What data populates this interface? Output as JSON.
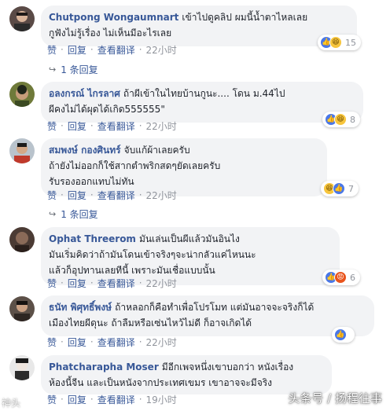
{
  "comments": [
    {
      "author": "Chutpong Wongaumnart",
      "text": "เข้าไปดูคลิป ผมนี้น้ำตาไหลเลย\nกูฟังไม่รู้เรื่อง ไม่เห็นมีอะไรเลย",
      "reactions": [
        "like",
        "haha"
      ],
      "reaction_count": "15",
      "like_label": "赞",
      "reply_label": "回复",
      "translate_label": "查看翻译",
      "time": "22小时",
      "replies_label": "1 条回复"
    },
    {
      "author": "อลงกรณ์ ไกรลาศ",
      "text": "ถ้าผีเข้าในไทยบ้านกูนะ.... โดน ม.44ไป\nผีคงไม่ได้ผุดได้เกิด555555\"",
      "reactions": [
        "like",
        "haha"
      ],
      "reaction_count": "8",
      "like_label": "赞",
      "reply_label": "回复",
      "translate_label": "查看翻译",
      "time": "22小时"
    },
    {
      "author": "สมพงษ์ กองศินทร์",
      "text": "จับแก้ผ้าเลยครับ\nถ้ายังไม่ออกก็ใช้สากตำพริกสดๆยัดเลยครับ\nรับรองออกแทบไม่ทัน",
      "reactions": [
        "haha",
        "like"
      ],
      "reaction_count": "7",
      "like_label": "赞",
      "reply_label": "回复",
      "translate_label": "查看翻译",
      "time": "22小时",
      "replies_label": "1 条回复"
    },
    {
      "author": "Ophat Threerom",
      "text": "มันเล่นเป็นผีแล้วมันอินไง\nมันเริ่มคิดว่าถ้ามันโดนเข้าจริงๆจะน่ากลัวแค่ไหนนะ\nแล้วก็อุปทานเลยทีนี้ เพราะมันเชื่อแบบนั้น",
      "reactions": [
        "like",
        "angry"
      ],
      "reaction_count": "6",
      "like_label": "赞",
      "reply_label": "回复",
      "translate_label": "查看翻译",
      "time": "22小时"
    },
    {
      "author": "ธนัท พิศุทธิ์พงษ์",
      "text": "ถ้าหลอกก็คือทำเพื่อโปรโมท แต่มันอาจจะจริงก็ได้\nเมืองไทยผีดุนะ ถ้าลืมหรือเซ่นไหว้ไม่ดี ก็อาจเกิดได้",
      "reactions": [
        "like"
      ],
      "reaction_count": "",
      "like_label": "赞",
      "reply_label": "回复",
      "translate_label": "查看翻译",
      "time": "22小时"
    },
    {
      "author": "Phatcharapha Moser",
      "text": "มีอีกเพจหนึ่งเขาบอกว่า หนังเรื่อง\nห้องนี้จีน และเป็นหนังจากประเทศเขมร เขาอาจจะมีจริง",
      "like_label": "赞",
      "reply_label": "回复",
      "translate_label": "查看翻译",
      "time": "19小时"
    }
  ],
  "icons": {
    "like": "thumbs-up-icon",
    "haha": "laughing-face-icon",
    "angry": "angry-face-icon",
    "reply_arrow": "reply-arrow-icon"
  },
  "colors": {
    "author": "#385898",
    "bubble": "#f2f3f5",
    "meta": "#90949c",
    "like_reaction": "#4a78e8",
    "haha_reaction": "#f7c53c",
    "angry_reaction": "#e9541c"
  },
  "watermark": "头条号 / 扬程往事",
  "watermark_left": "神头"
}
